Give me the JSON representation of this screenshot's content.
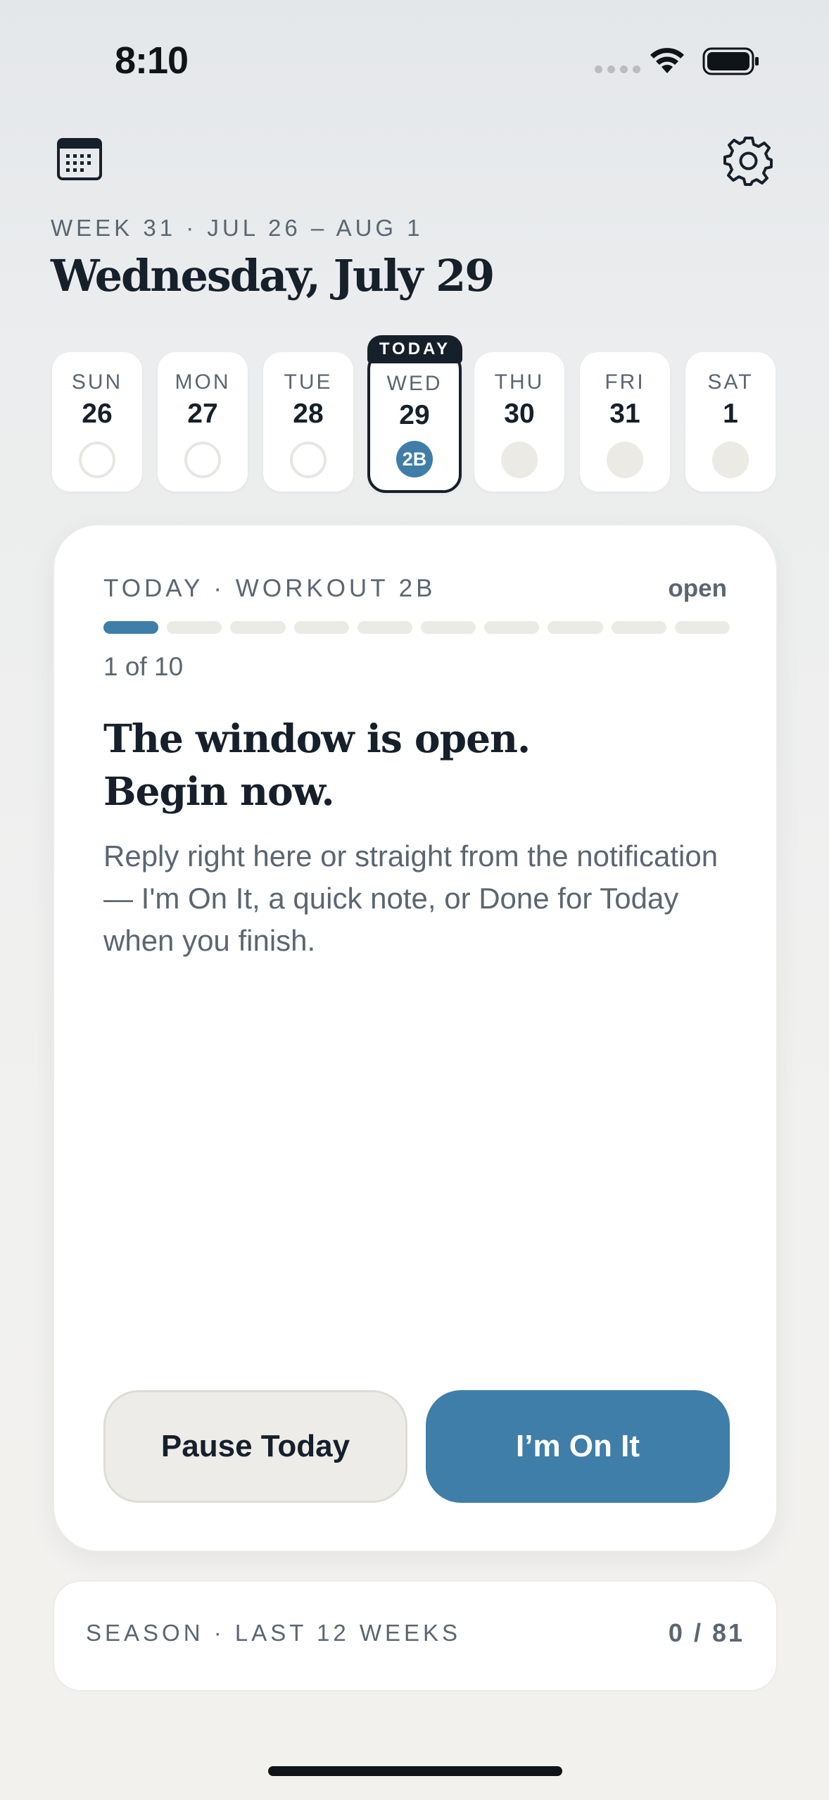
{
  "status_bar": {
    "time": "8:10",
    "icons": [
      "signal-icon",
      "wifi-icon",
      "battery-icon"
    ]
  },
  "header": {
    "calendar_icon": "calendar-icon",
    "settings_icon": "gear-icon",
    "week_label": "WEEK 31 · JUL 26 – AUG 1",
    "title": "Wednesday, July 29"
  },
  "week": {
    "today_tab": "TODAY",
    "days": [
      {
        "name": "SUN",
        "num": "26",
        "status": "empty",
        "badge": ""
      },
      {
        "name": "MON",
        "num": "27",
        "status": "empty",
        "badge": ""
      },
      {
        "name": "TUE",
        "num": "28",
        "status": "empty",
        "badge": ""
      },
      {
        "name": "WED",
        "num": "29",
        "status": "active",
        "badge": "2B"
      },
      {
        "name": "THU",
        "num": "30",
        "status": "future",
        "badge": ""
      },
      {
        "name": "FRI",
        "num": "31",
        "status": "future",
        "badge": ""
      },
      {
        "name": "SAT",
        "num": "1",
        "status": "future",
        "badge": ""
      }
    ]
  },
  "card": {
    "kicker": "TODAY · WORKOUT 2B",
    "state": "open",
    "progress": {
      "current": 1,
      "total": 10
    },
    "step_count": "1 of 10",
    "headline_line1": "The window is open.",
    "headline_line2": "Begin now.",
    "body": "Reply right here or straight from the notification — I'm On It, a quick note, or Done for Today when you finish.",
    "pause_label": "Pause Today",
    "on_it_label": "I’m On It"
  },
  "season": {
    "label": "SEASON · LAST 12 WEEKS",
    "value": "0 / 81"
  },
  "colors": {
    "accent": "#3f7ea8",
    "ink": "#16202b",
    "muted": "#5b6672",
    "track": "#ebeae4"
  }
}
